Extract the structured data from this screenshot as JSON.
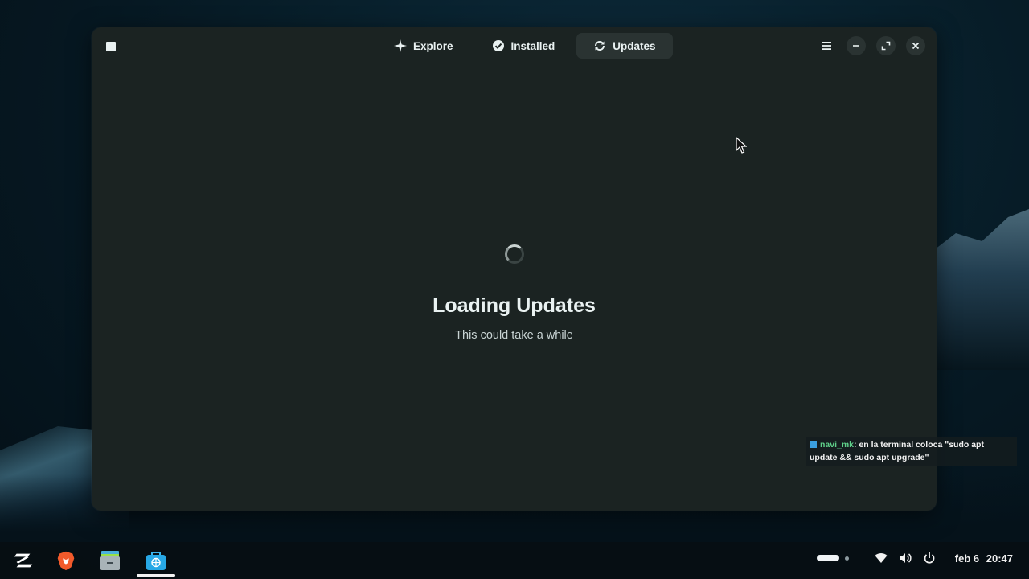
{
  "window": {
    "tabs": [
      {
        "label": "Explore",
        "icon": "sparkle-icon",
        "active": false
      },
      {
        "label": "Installed",
        "icon": "check-circle-icon",
        "active": false
      },
      {
        "label": "Updates",
        "icon": "refresh-icon",
        "active": true
      }
    ],
    "header_buttons": [
      "menu-icon",
      "minimize-icon",
      "maximize-icon",
      "close-icon"
    ]
  },
  "main": {
    "title": "Loading Updates",
    "subtitle": "This could take a while"
  },
  "chat": {
    "user": "navi_mk",
    "message": ": en la terminal coloca \"sudo apt update && sudo apt upgrade\""
  },
  "taskbar": {
    "apps": [
      "zorin-menu-icon",
      "brave-browser-icon",
      "files-icon",
      "software-store-icon"
    ],
    "active_app": "software-store-icon",
    "clock": {
      "date": "feb 6",
      "time": "20:47"
    }
  },
  "colors": {
    "window_bg": "#1b2322",
    "active_tab_bg": "#2a3332",
    "text": "#eaf2f2"
  }
}
